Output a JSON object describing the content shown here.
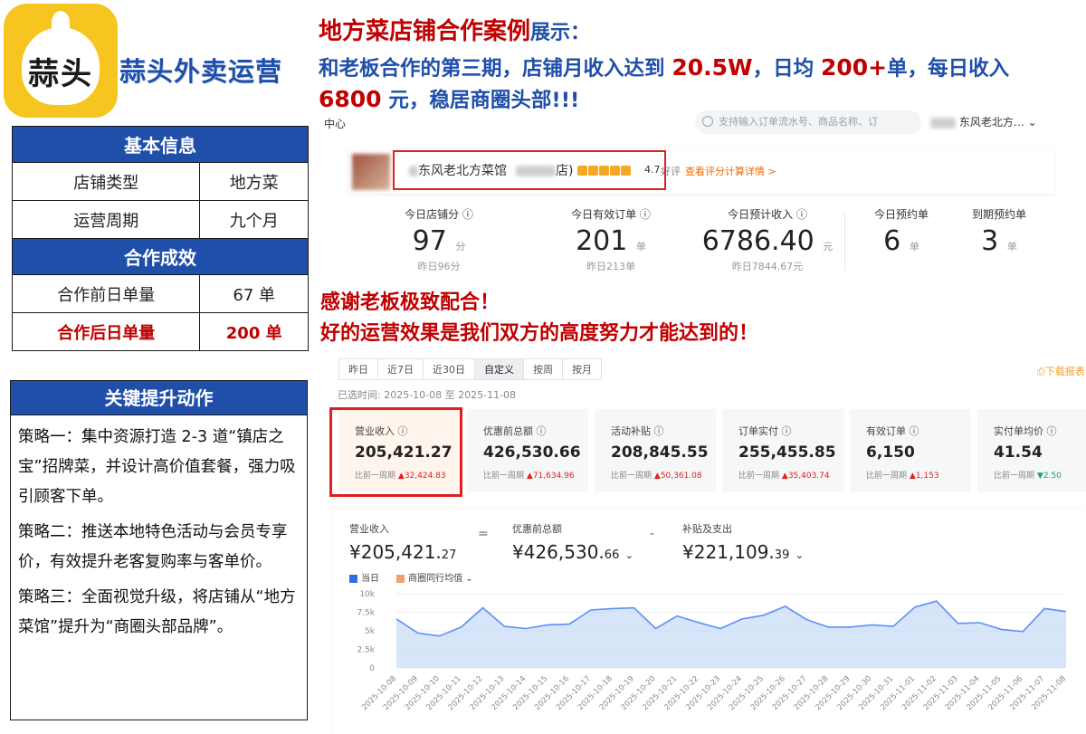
{
  "brand": {
    "logo_text": "蒜头",
    "name": "蒜头外卖运营"
  },
  "basic_info": {
    "title": "基本信息",
    "rows": [
      {
        "label": "店铺类型",
        "value": "地方菜"
      },
      {
        "label": "运营周期",
        "value": "九个月"
      }
    ]
  },
  "results": {
    "title": "合作成效",
    "rows": [
      {
        "label": "合作前日单量",
        "value": "67 单"
      },
      {
        "label": "合作后日单量",
        "value": "200 单"
      }
    ]
  },
  "strategies": {
    "title": "关键提升动作",
    "items": [
      "策略一：集中资源打造 2-3 道“镇店之宝”招牌菜，并设计高价值套餐，强力吸引顾客下单。",
      "策略二：推送本地特色活动与会员专享价，有效提升老客复购率与客单价。",
      "策略三：全面视觉升级，将店铺从“地方菜馆”提升为“商圈头部品牌”。"
    ]
  },
  "headline": {
    "main": "地方菜店铺合作案例",
    "tail": "展示：",
    "sub_1": "和老板合作的第三期，店铺月收入达到 ",
    "sub_hl_1": "20.5W",
    "sub_2": "，日均 ",
    "sub_hl_2": "200+",
    "sub_3": "单，每日收入 ",
    "sub_hl_3": "6800",
    "sub_4": " 元，稳居商圈头部!!!"
  },
  "app": {
    "center_label": "中心",
    "search_placeholder": "支持输入订单流水号、商品名称、订",
    "store_top": "东风老北方…",
    "store_name": "东风老北方菜馆",
    "store_suffix": "店)",
    "rating": "4.7",
    "rating_note": "好评",
    "rating_link": "查看评分计算详情 >",
    "kpis": [
      {
        "label": "今日店铺分",
        "value": "97",
        "unit": "分",
        "sub": "昨日96分"
      },
      {
        "label": "今日有效订单",
        "value": "201",
        "unit": "单",
        "sub": "昨日213单"
      },
      {
        "label": "今日预计收入",
        "value": "6786.40",
        "unit": "元",
        "sub": "昨日7844.67元"
      },
      {
        "label": "今日预约单",
        "value": "6",
        "unit": "单",
        "sub": ""
      },
      {
        "label": "到期预约单",
        "value": "3",
        "unit": "单",
        "sub": ""
      }
    ]
  },
  "thanks": {
    "line1": "感谢老板极致配合！",
    "line2": "好的运营效果是我们双方的高度努力才能达到的！"
  },
  "filters": {
    "tabs": [
      "昨日",
      "近7日",
      "近30日",
      "自定义",
      "按周",
      "按月"
    ],
    "active": "自定义",
    "download": "下载报表",
    "selected_range": "已选时间:  2025-10-08 至 2025-11-08"
  },
  "metrics": [
    {
      "label": "营业收入",
      "value": "205,421.27",
      "cmp_label": "比前一周期",
      "cmp": "32,424.83",
      "dir": "up"
    },
    {
      "label": "优惠前总额",
      "value": "426,530.66",
      "cmp_label": "比前一周期",
      "cmp": "71,634.96",
      "dir": "up"
    },
    {
      "label": "活动补贴",
      "value": "208,845.55",
      "cmp_label": "比前一周期",
      "cmp": "50,361.08",
      "dir": "up"
    },
    {
      "label": "订单实付",
      "value": "255,455.85",
      "cmp_label": "比前一周期",
      "cmp": "35,403.74",
      "dir": "up"
    },
    {
      "label": "有效订单",
      "value": "6,150",
      "cmp_label": "比前一周期",
      "cmp": "1,153",
      "dir": "up"
    },
    {
      "label": "实付单均价",
      "value": "41.54",
      "cmp_label": "比前一周期",
      "cmp": "2.50",
      "dir": "down"
    }
  ],
  "summary": {
    "revenue_label": "营业收入",
    "revenue_int": "¥205,421.",
    "revenue_dec": "27",
    "eq": "=",
    "pre_label": "优惠前总额",
    "pre_int": "¥426,530.",
    "pre_dec": "66",
    "minus": "-",
    "sub_label": "补贴及支出",
    "sub_int": "¥221,109.",
    "sub_dec": "39",
    "legend_a": "当日",
    "legend_b": "商圈同行均值"
  },
  "colors": {
    "brand_blue": "#1f4fa8",
    "accent_red": "#c00000",
    "chart_line": "#5b8ff9",
    "chart_fill": "#c9dcf7"
  },
  "chart_data": {
    "type": "area",
    "x": [
      "2025-10-08",
      "2025-10-09",
      "2025-10-10",
      "2025-10-11",
      "2025-10-12",
      "2025-10-13",
      "2025-10-14",
      "2025-10-15",
      "2025-10-16",
      "2025-10-17",
      "2025-10-18",
      "2025-10-19",
      "2025-10-20",
      "2025-10-21",
      "2025-10-22",
      "2025-10-23",
      "2025-10-24",
      "2025-10-25",
      "2025-10-26",
      "2025-10-27",
      "2025-10-28",
      "2025-10-29",
      "2025-10-30",
      "2025-10-31",
      "2025-11-01",
      "2025-11-02",
      "2025-11-03",
      "2025-11-04",
      "2025-11-05",
      "2025-11-06",
      "2025-11-07",
      "2025-11-08"
    ],
    "series": [
      {
        "name": "当日",
        "values": [
          6600,
          4700,
          4300,
          5500,
          8100,
          5600,
          5300,
          5800,
          5900,
          7800,
          8000,
          8100,
          5300,
          7000,
          6100,
          5300,
          6600,
          7100,
          8300,
          6500,
          5500,
          5500,
          5800,
          5600,
          8200,
          9000,
          6000,
          6100,
          5200,
          4900,
          8000,
          7600
        ]
      }
    ],
    "y_ticks": [
      "0",
      "2.5k",
      "5k",
      "7.5k",
      "10k"
    ],
    "ylim": [
      0,
      10000
    ],
    "grid": true
  }
}
